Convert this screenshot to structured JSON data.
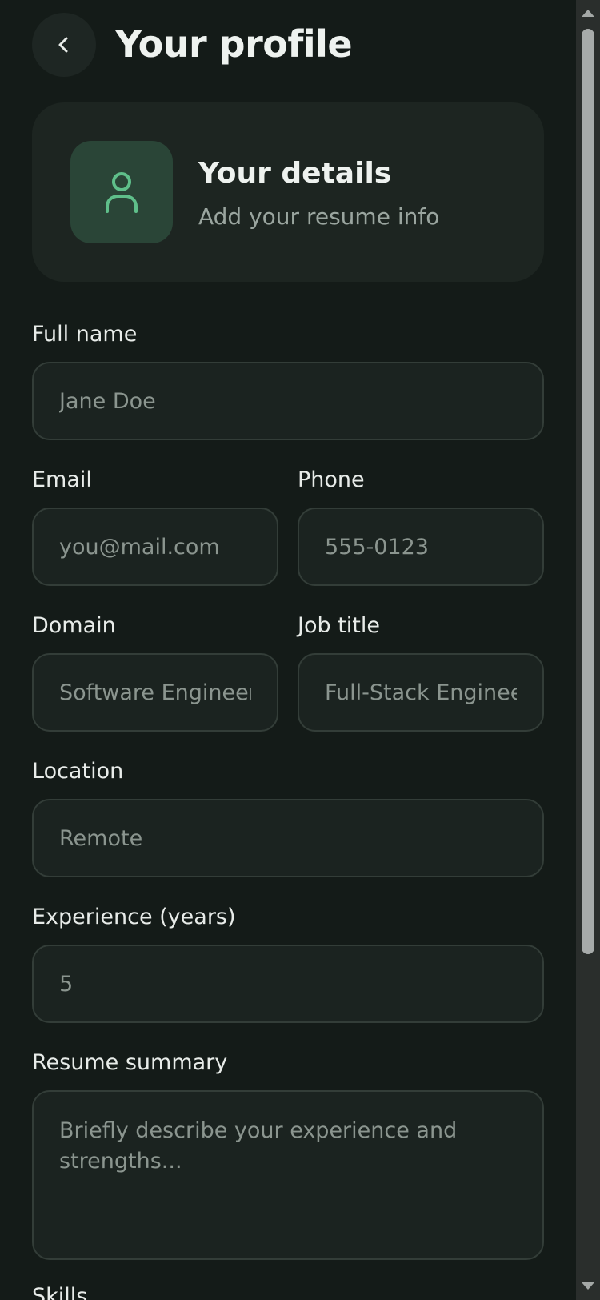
{
  "header": {
    "title": "Your profile",
    "back_icon": "chevron-left-icon"
  },
  "details_card": {
    "icon": "user-icon",
    "title": "Your details",
    "subtitle": "Add your resume info"
  },
  "form": {
    "full_name": {
      "label": "Full name",
      "placeholder": "Jane Doe",
      "value": ""
    },
    "email": {
      "label": "Email",
      "placeholder": "you@mail.com",
      "value": ""
    },
    "phone": {
      "label": "Phone",
      "placeholder": "555-0123",
      "value": ""
    },
    "domain": {
      "label": "Domain",
      "placeholder": "Software Engineer",
      "value": ""
    },
    "job_title": {
      "label": "Job title",
      "placeholder": "Full-Stack Engineer",
      "value": ""
    },
    "location": {
      "label": "Location",
      "placeholder": "Remote",
      "value": ""
    },
    "experience": {
      "label": "Experience (years)",
      "placeholder": "5",
      "value": ""
    },
    "summary": {
      "label": "Resume summary",
      "placeholder": "Briefly describe your experience and strengths...",
      "value": ""
    },
    "skills": {
      "label": "Skills"
    }
  },
  "colors": {
    "background": "#141b18",
    "card": "#1d2521",
    "accent": "#5fbf8a",
    "accent_bg": "#2a4537"
  }
}
